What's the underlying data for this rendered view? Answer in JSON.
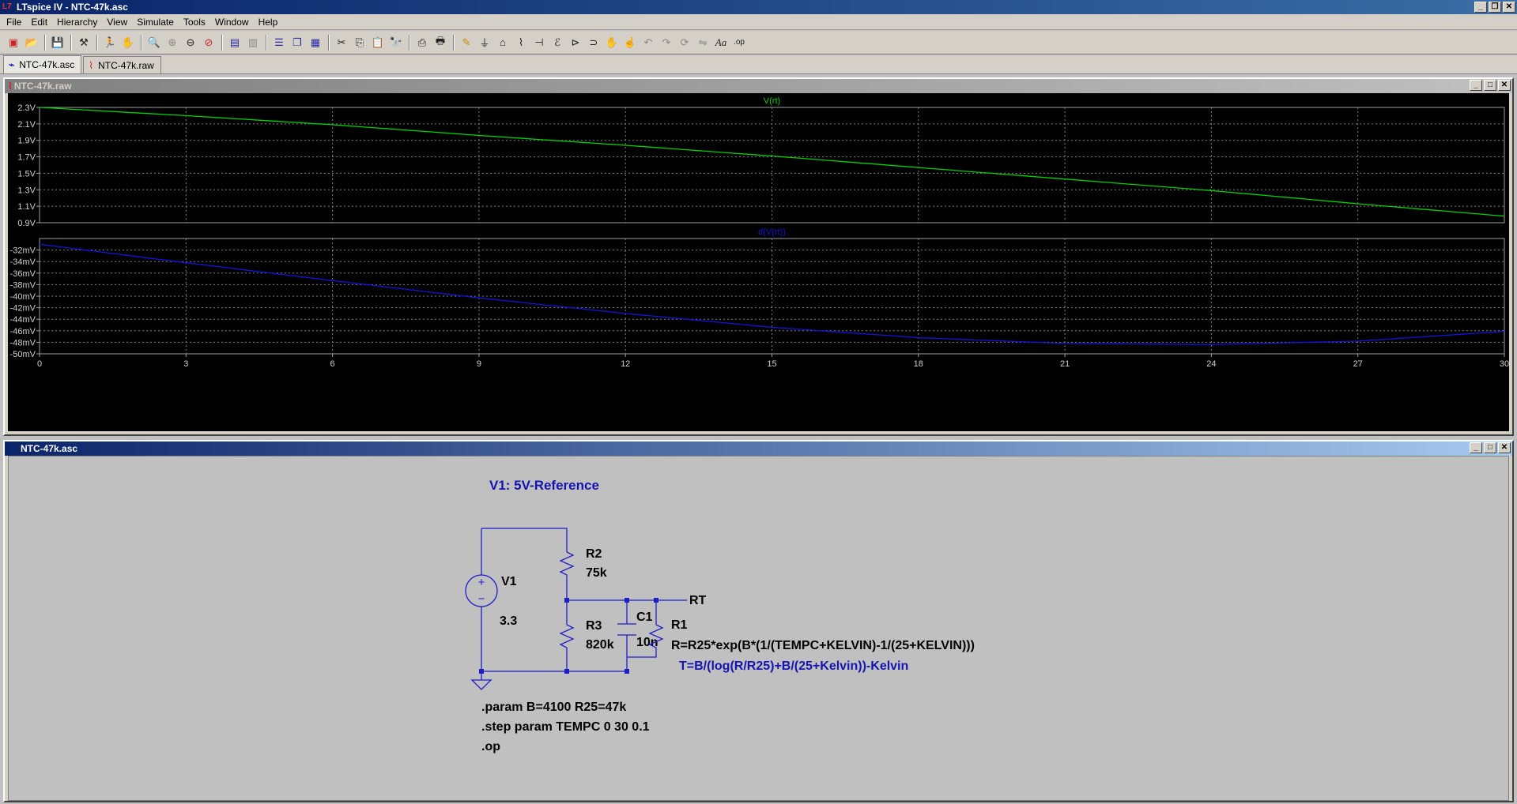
{
  "app": {
    "title": "LTspice IV - NTC-47k.asc",
    "icon": "ltspice-logo"
  },
  "menu": [
    "File",
    "Edit",
    "Hierarchy",
    "View",
    "Simulate",
    "Tools",
    "Window",
    "Help"
  ],
  "toolbar": {
    "icons": [
      "new-schematic-icon",
      "open-icon",
      "save-icon",
      "control-panel-icon",
      "run-icon",
      "halt-icon",
      "zoom-in-icon",
      "zoom-fit-icon",
      "zoom-out-icon",
      "zoom-cancel-icon",
      "autorange-icon",
      "plot-settings-icon",
      "tile-horizontal-icon",
      "cascade-icon",
      "tile-vertical-icon",
      "cut-icon",
      "copy-icon",
      "paste-icon",
      "find-icon",
      "print-setup-icon",
      "print-icon",
      "draw-wire-icon",
      "ground-icon",
      "label-net-icon",
      "resistor-icon",
      "capacitor-icon",
      "inductor-icon",
      "diode-icon",
      "component-icon",
      "move-icon",
      "drag-icon",
      "undo-icon",
      "redo-icon",
      "rotate-icon",
      "mirror-icon",
      "text-icon",
      "spice-directive-icon"
    ]
  },
  "tabs": [
    {
      "label": "NTC-47k.asc",
      "icon": "schematic-icon",
      "active": true
    },
    {
      "label": "NTC-47k.raw",
      "icon": "waveform-icon",
      "active": false
    }
  ],
  "plot_window": {
    "title": "NTC-47k.raw"
  },
  "schematic_window": {
    "title": "NTC-47k.asc"
  },
  "colors": {
    "trace1": "#00d000",
    "trace2": "#1414d8",
    "grid": "#808080",
    "wire": "#1e1ec8",
    "text_blue": "#1414b4"
  },
  "chart_data": [
    {
      "type": "line",
      "title": "V(rt)",
      "x": [
        0,
        3,
        6,
        9,
        12,
        15,
        18,
        21,
        24,
        27,
        30
      ],
      "x_ticks": [
        "0",
        "3",
        "6",
        "9",
        "12",
        "15",
        "18",
        "21",
        "24",
        "27",
        "30"
      ],
      "xlim": [
        0,
        30
      ],
      "series": [
        {
          "name": "V(rt)",
          "color": "#00d000",
          "values": [
            2.3,
            2.2,
            2.09,
            1.96,
            1.84,
            1.71,
            1.57,
            1.43,
            1.29,
            1.13,
            0.98
          ]
        }
      ],
      "y_ticks": [
        "0.9V",
        "1.1V",
        "1.3V",
        "1.5V",
        "1.7V",
        "1.9V",
        "2.1V",
        "2.3V"
      ],
      "ylim": [
        0.9,
        2.3
      ],
      "grid": true
    },
    {
      "type": "line",
      "title": "d(V(rt))",
      "x": [
        0,
        3,
        6,
        9,
        12,
        15,
        18,
        21,
        24,
        27,
        30
      ],
      "xlim": [
        0,
        30
      ],
      "series": [
        {
          "name": "d(V(rt))",
          "color": "#1414d8",
          "values": [
            -31.0,
            -34.2,
            -37.3,
            -40.3,
            -43.0,
            -45.4,
            -47.2,
            -48.2,
            -48.4,
            -47.8,
            -46.1
          ]
        }
      ],
      "y_ticks": [
        "-32mV",
        "-34mV",
        "-36mV",
        "-38mV",
        "-40mV",
        "-42mV",
        "-44mV",
        "-46mV",
        "-48mV",
        "-50mV"
      ],
      "ylim": [
        -50,
        -30
      ],
      "grid": true
    }
  ],
  "schematic": {
    "header": "V1: 5V-Reference",
    "v1_name": "V1",
    "v1_value": "3.3",
    "r2_name": "R2",
    "r2_value": "75k",
    "r3_name": "R3",
    "r3_value": "820k",
    "c1_name": "C1",
    "c1_value": "10n",
    "r1_name": "R1",
    "r1_value": "R=R25*exp(B*(1/(TEMPC+KELVIN)-1/(25+KELVIN)))",
    "net_label": "RT",
    "comment": "T=B/(log(R/R25)+B/(25+Kelvin))-Kelvin",
    "directives": [
      ".param B=4100 R25=47k",
      ".step param TEMPC 0 30 0.1",
      ".op"
    ]
  }
}
